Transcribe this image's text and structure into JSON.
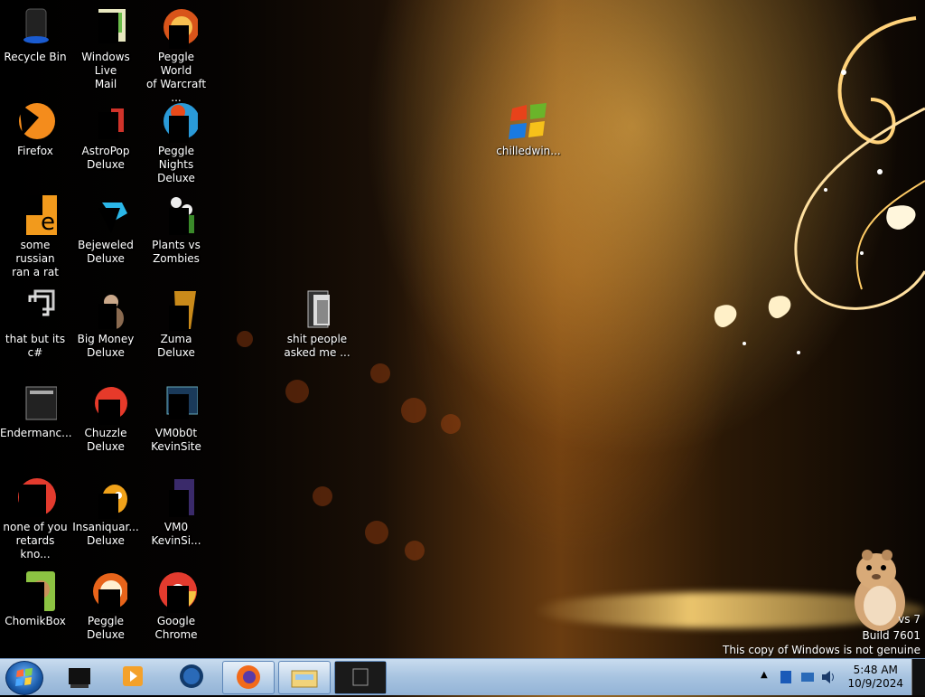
{
  "desktop": {
    "icons": [
      {
        "label": "Recycle Bin",
        "icon": "recycle-bin-icon"
      },
      {
        "label": "Windows Live\nMail",
        "icon": "mail-icon"
      },
      {
        "label": "Peggle World\nof Warcraft ...",
        "icon": "peggle-wow-icon"
      },
      {
        "label": "Firefox",
        "icon": "firefox-icon"
      },
      {
        "label": "AstroPop\nDeluxe",
        "icon": "astropop-icon"
      },
      {
        "label": "Peggle Nights\nDeluxe",
        "icon": "peggle-nights-icon"
      },
      {
        "label": "some russian\nran a rat",
        "icon": "shortcut-e-icon"
      },
      {
        "label": "Bejeweled\nDeluxe",
        "icon": "bejeweled-icon"
      },
      {
        "label": "Plants vs\nZombies",
        "icon": "plants-vs-zombies-icon"
      },
      {
        "label": "that but its c#",
        "icon": "shortcut-icon"
      },
      {
        "label": "Big Money\nDeluxe",
        "icon": "big-money-icon"
      },
      {
        "label": "Zuma Deluxe",
        "icon": "zuma-icon"
      },
      {
        "label": "Endermanc...",
        "icon": "terminal-icon"
      },
      {
        "label": "Chuzzle\nDeluxe",
        "icon": "chuzzle-icon"
      },
      {
        "label": "VM0b0t\nKevinSite",
        "icon": "window-icon"
      },
      {
        "label": "none of you\nretards kno...",
        "icon": "chrome-icon"
      },
      {
        "label": "Insaniquar...\nDeluxe",
        "icon": "insaniquarium-icon"
      },
      {
        "label": "VM0\nKevinSi...",
        "icon": "file-icon"
      },
      {
        "label": "ChomikBox",
        "icon": "chomikbox-icon"
      },
      {
        "label": "Peggle Deluxe",
        "icon": "peggle-icon"
      },
      {
        "label": "Google\nChrome",
        "icon": "chrome-icon"
      },
      {
        "label": "chilledwin...",
        "icon": "windows-logo-icon"
      },
      {
        "label": "shit people\nasked me ...",
        "icon": "folder-icon"
      }
    ]
  },
  "watermark": {
    "line1": "vs 7",
    "line2": "Build 7601",
    "line3": "This copy of Windows is not genuine"
  },
  "taskbar": {
    "pinned": [
      "media-center-icon",
      "media-player-icon",
      "globe-icon",
      "firefox-icon",
      "explorer-icon",
      "terminal-icon"
    ],
    "clock_time": "5:48 AM",
    "clock_date": "10/9/2024"
  }
}
